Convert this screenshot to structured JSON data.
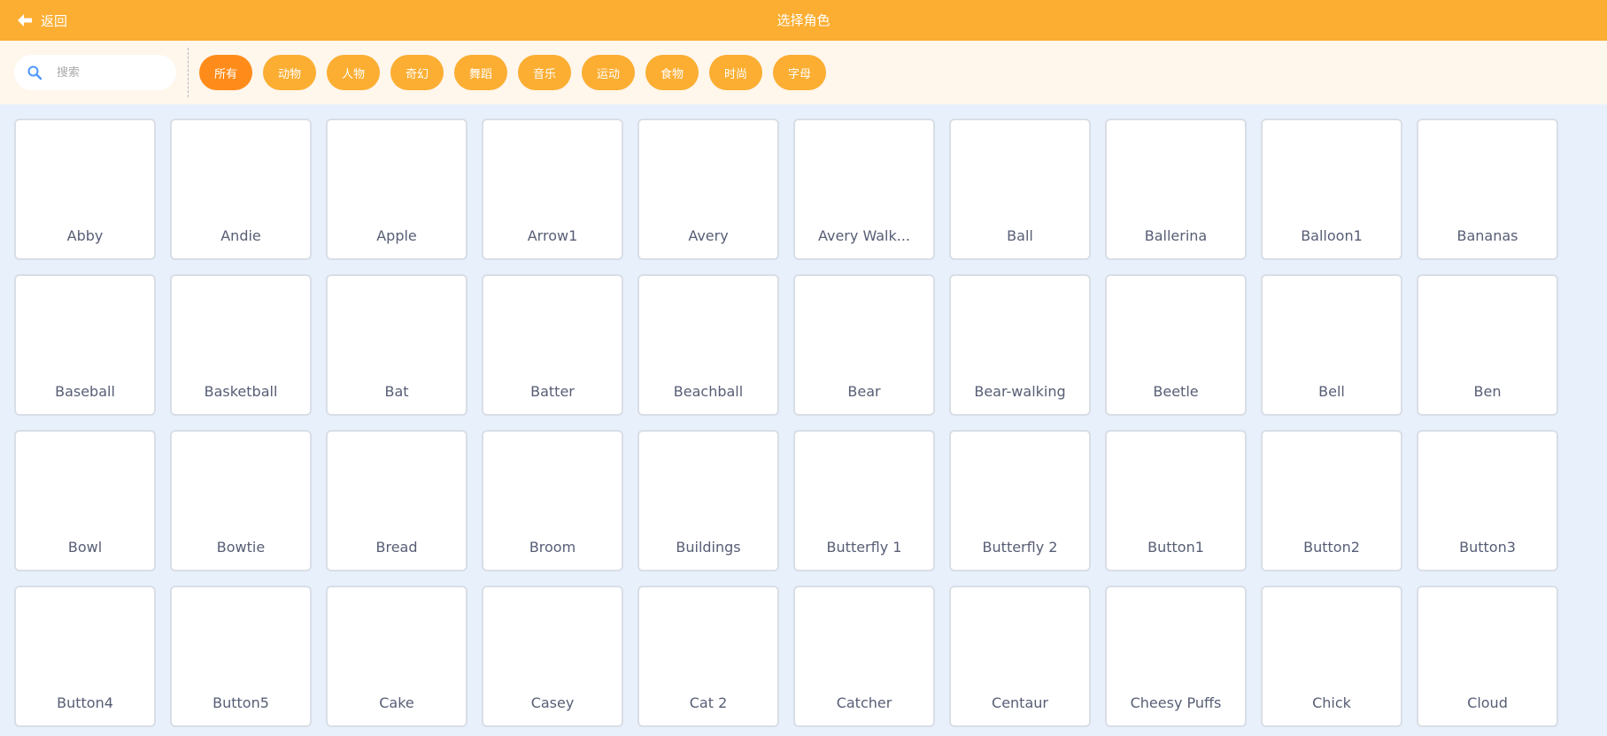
{
  "header": {
    "back_label": "返回",
    "title": "选择角色",
    "back_icon": "arrow-left-icon"
  },
  "search": {
    "placeholder": "搜索",
    "value": "",
    "icon": "search-icon"
  },
  "tabs": [
    {
      "label": "所有",
      "active": true
    },
    {
      "label": "动物",
      "active": false
    },
    {
      "label": "人物",
      "active": false
    },
    {
      "label": "奇幻",
      "active": false
    },
    {
      "label": "舞蹈",
      "active": false
    },
    {
      "label": "音乐",
      "active": false
    },
    {
      "label": "运动",
      "active": false
    },
    {
      "label": "食物",
      "active": false
    },
    {
      "label": "时尚",
      "active": false
    },
    {
      "label": "字母",
      "active": false
    }
  ],
  "sprites": [
    "Abby",
    "Andie",
    "Apple",
    "Arrow1",
    "Avery",
    "Avery Walk...",
    "Ball",
    "Ballerina",
    "Balloon1",
    "Bananas",
    "Baseball",
    "Basketball",
    "Bat",
    "Batter",
    "Beachball",
    "Bear",
    "Bear-walking",
    "Beetle",
    "Bell",
    "Ben",
    "Bowl",
    "Bowtie",
    "Bread",
    "Broom",
    "Buildings",
    "Butterfly 1",
    "Butterfly 2",
    "Button1",
    "Button2",
    "Button3",
    "Button4",
    "Button5",
    "Cake",
    "Casey",
    "Cat 2",
    "Catcher",
    "Centaur",
    "Cheesy Puffs",
    "Chick",
    "Cloud"
  ],
  "colors": {
    "header_bg": "#FBAE32",
    "tab_bg": "#FBAE32",
    "tab_active_bg": "#FF8C1A",
    "filter_bar_bg": "#FFF6EC",
    "page_bg": "#E8F0FB",
    "search_icon": "#4C97FF",
    "sprite_text": "#575E75"
  }
}
